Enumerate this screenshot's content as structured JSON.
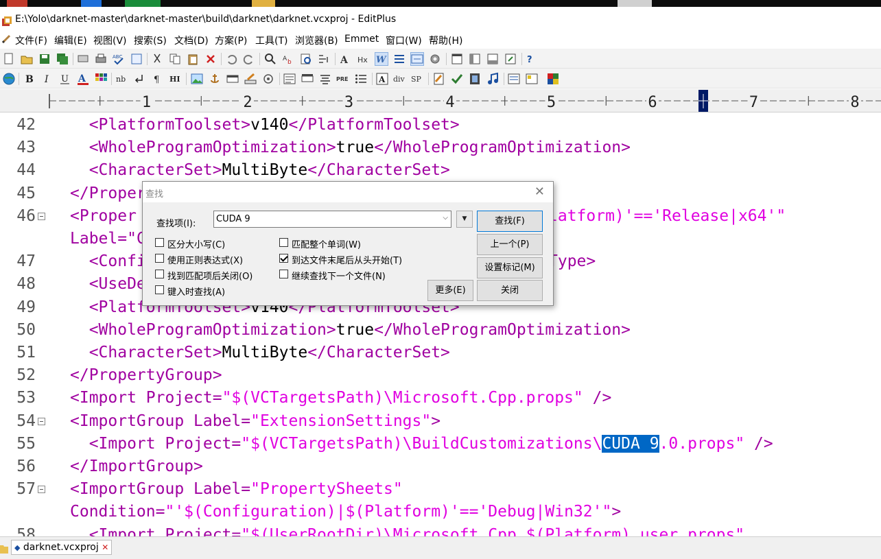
{
  "window": {
    "title": "E:\\Yolo\\darknet-master\\darknet-master\\build\\darknet\\darknet.vcxproj - EditPlus"
  },
  "menu": [
    {
      "id": "file",
      "label": "文件(F)"
    },
    {
      "id": "edit",
      "label": "编辑(E)"
    },
    {
      "id": "view",
      "label": "视图(V)"
    },
    {
      "id": "search",
      "label": "搜索(S)"
    },
    {
      "id": "document",
      "label": "文档(D)"
    },
    {
      "id": "project",
      "label": "方案(P)"
    },
    {
      "id": "tools",
      "label": "工具(T)"
    },
    {
      "id": "browser",
      "label": "浏览器(B)"
    },
    {
      "id": "emmet",
      "label": "Emmet"
    },
    {
      "id": "window",
      "label": "窗口(W)"
    },
    {
      "id": "help",
      "label": "帮助(H)"
    }
  ],
  "toolbar2_text": {
    "pre": "PRE",
    "div": "div",
    "sp": "SP",
    "hx": "Hx",
    "hi": "HI",
    "nb": "nb"
  },
  "ruler": {
    "marks": [
      "1",
      "2",
      "3",
      "4",
      "5",
      "6",
      "7",
      "8"
    ]
  },
  "editor": {
    "line_numbers": [
      "42",
      "43",
      "44",
      "45",
      "46",
      "47",
      "48",
      "49",
      "50",
      "51",
      "52",
      "53",
      "54",
      "55",
      "56",
      "57",
      "58"
    ],
    "lines": [
      {
        "a": "  <PlatformToolset>",
        "b": "v140",
        "c": "</PlatformToolset>"
      },
      {
        "a": "  <WholeProgramOptimization>",
        "b": "true",
        "c": "</WholeProgramOptimization>"
      },
      {
        "a": "  <CharacterSet>",
        "b": "MultiByte",
        "c": "</CharacterSet>"
      },
      {
        "a": "</Proper",
        "b": "",
        "c": ""
      },
      {
        "a": "<Proper",
        "b": "",
        "c": "latform)'=='Release|x64'\""
      },
      {
        "a": "Label=\"C",
        "b": "",
        "c": ""
      },
      {
        "a": "  <Confi",
        "b": "",
        "c": "Type>"
      },
      {
        "a": "  <UseDe",
        "b": "",
        "c": ""
      },
      {
        "a": "  <PlatformToolset>",
        "b": "v140",
        "c": "</PlatformToolset>"
      },
      {
        "a": "  <WholeProgramOptimization>",
        "b": "true",
        "c": "</WholeProgramOptimization>"
      },
      {
        "a": "  <CharacterSet>",
        "b": "MultiByte",
        "c": "</CharacterSet>"
      },
      {
        "a": "</PropertyGroup>",
        "b": "",
        "c": ""
      },
      {
        "a": "<Import Project=",
        "b": "\"$(VCTargetsPath)\\Microsoft.Cpp.props\"",
        "c": " />"
      },
      {
        "a": "<ImportGroup Label=",
        "b": "\"ExtensionSettings\"",
        "c": ">"
      },
      {
        "a": "  <Import Project=",
        "b": "\"$(VCTargetsPath)\\BuildCustomizations\\",
        "sel": "CUDA 9",
        "d": ".0.props\"",
        "c": " />"
      },
      {
        "a": "</ImportGroup>",
        "b": "",
        "c": ""
      },
      {
        "a": "<ImportGroup Label=",
        "b": "\"PropertySheets\"",
        "c": ""
      },
      {
        "a": "Condition=",
        "b": "\"'$(Configuration)|$(Platform)'=='Debug|Win32'\"",
        "c": ">"
      },
      {
        "a": "  <Import Project=",
        "b": "\"$(UserRootDir)\\Microsoft.Cpp.$(Platform).user.props\"",
        "c": ""
      }
    ]
  },
  "tab": {
    "label": "darknet.vcxproj"
  },
  "find_dialog": {
    "title": "查找",
    "find_label": "查找项(I):",
    "find_value": "CUDA 9",
    "buttons": {
      "find": "查找(F)",
      "prev": "上一个(P)",
      "mark": "设置标记(M)",
      "more": "更多(E)",
      "close": "关闭"
    },
    "options": [
      {
        "id": "case",
        "label": "区分大小写(C)",
        "checked": false
      },
      {
        "id": "whole",
        "label": "匹配整个单词(W)",
        "checked": false
      },
      {
        "id": "regex",
        "label": "使用正则表达式(X)",
        "checked": false
      },
      {
        "id": "wrap",
        "label": "到达文件末尾后从头开始(T)",
        "checked": true
      },
      {
        "id": "closeonfind",
        "label": "找到匹配项后关闭(O)",
        "checked": false
      },
      {
        "id": "nextfile",
        "label": "继续查找下一个文件(N)",
        "checked": false
      },
      {
        "id": "incremental",
        "label": "键入时查找(A)",
        "checked": false
      }
    ]
  }
}
